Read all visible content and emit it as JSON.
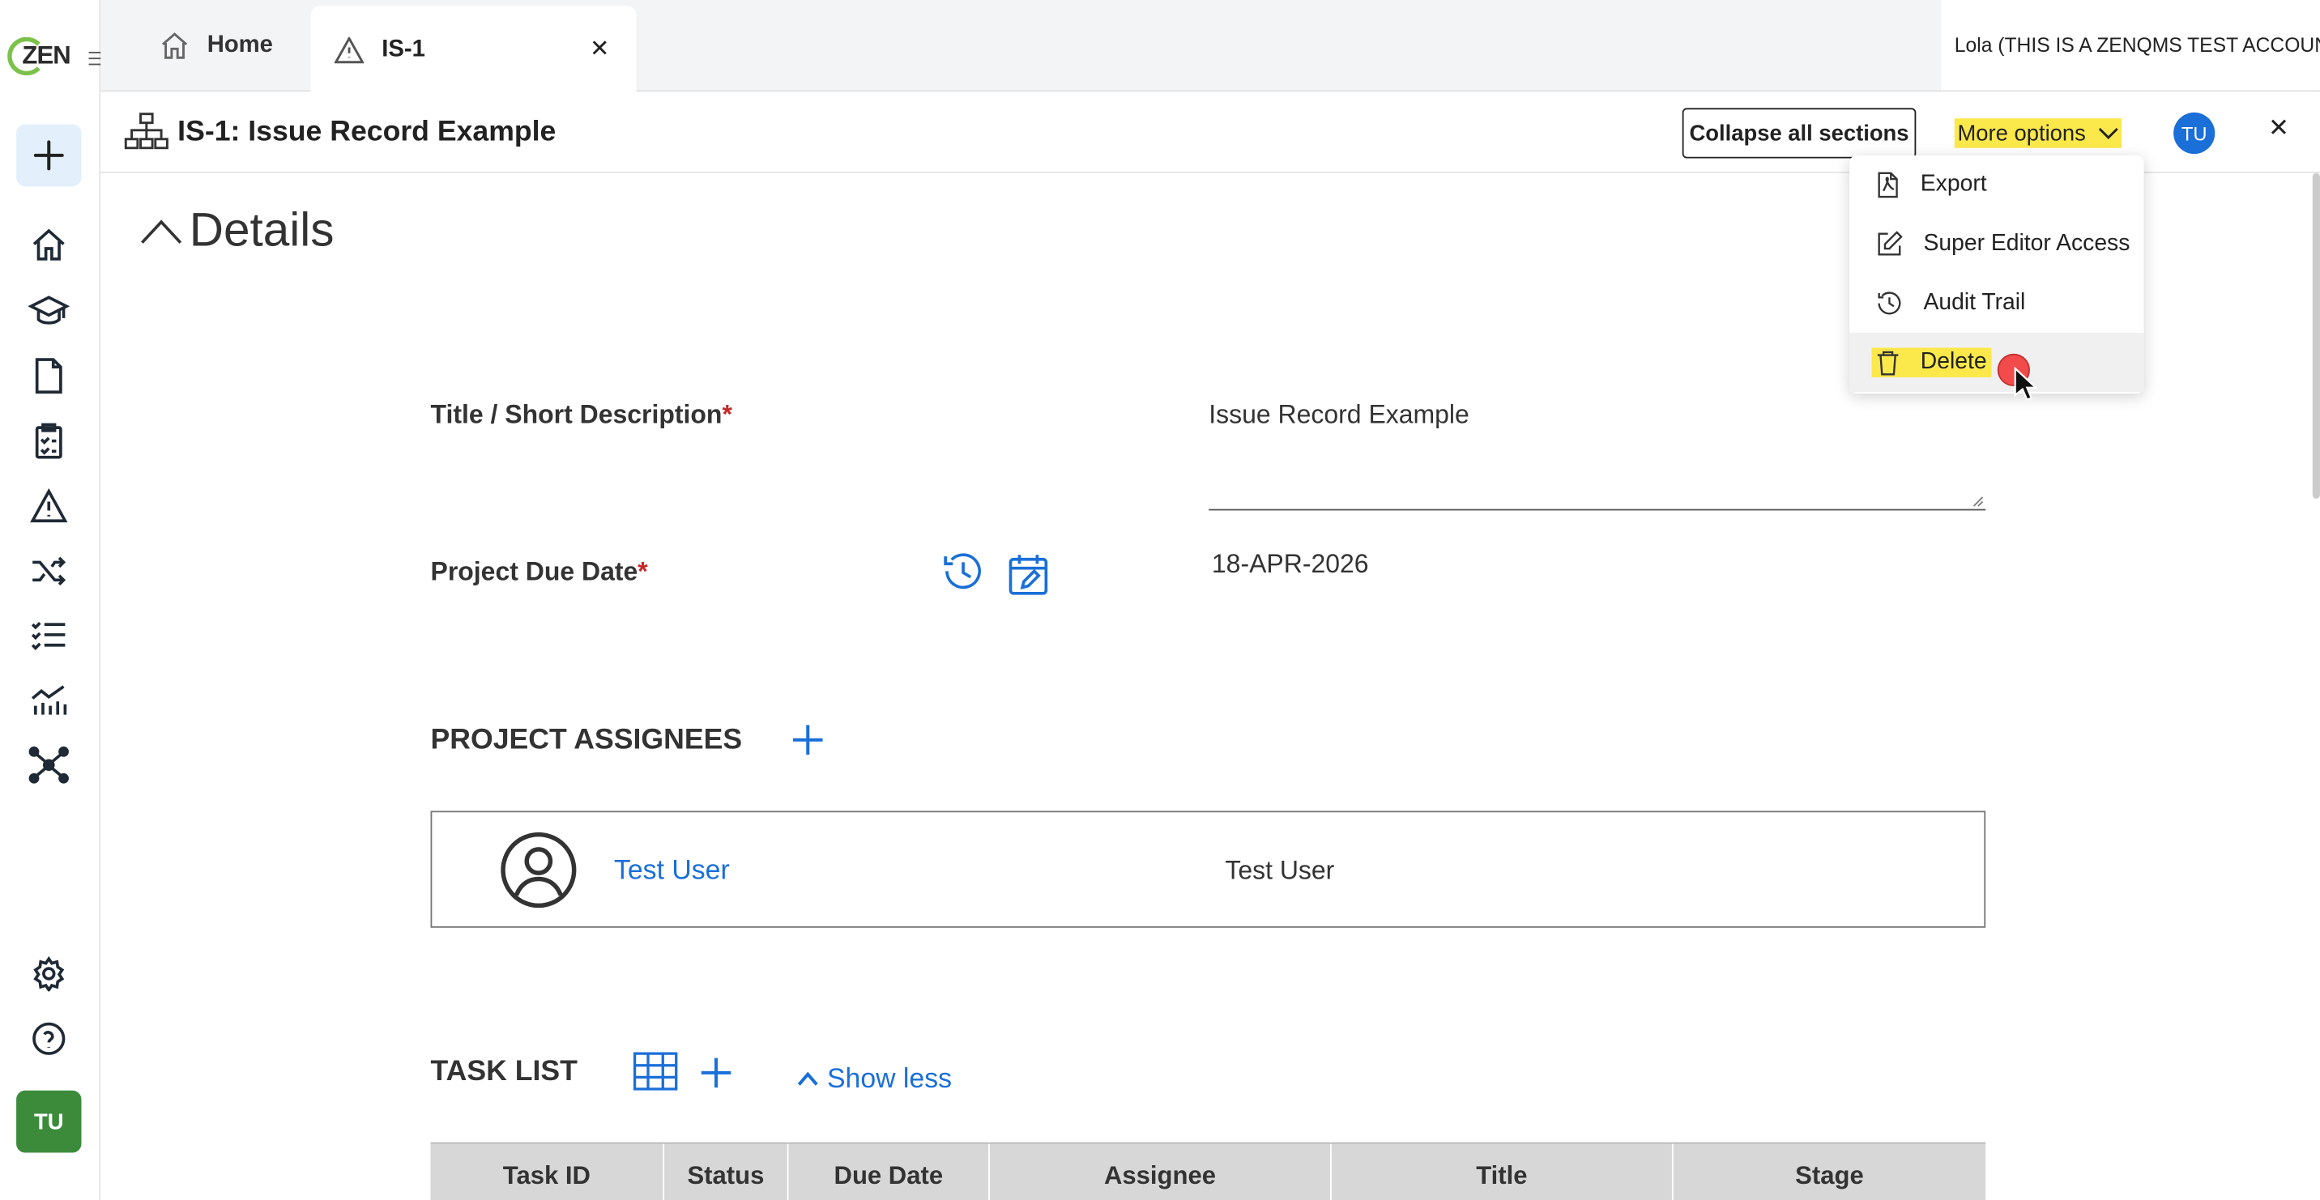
{
  "brand": {
    "logo_text": "ZEN",
    "accent": "#1a6fd8",
    "logo_green": "#7cc24a"
  },
  "sidebar": {
    "user_initials": "TU",
    "icons": [
      "plus-icon",
      "home-icon",
      "graduation-cap-icon",
      "document-icon",
      "clipboard-check-icon",
      "warning-icon",
      "shuffle-icon",
      "checklist-icon",
      "chart-icon",
      "network-icon",
      "gear-icon",
      "help-icon"
    ]
  },
  "tabs": [
    {
      "label": "Home",
      "icon": "home-icon"
    },
    {
      "label": "IS-1",
      "icon": "warning-icon",
      "active": true
    }
  ],
  "account_label": "Lola (THIS IS A ZENQMS TEST ACCOUNT)",
  "header": {
    "title": "IS-1: Issue Record Example",
    "collapse_label": "Collapse all sections",
    "more_options_label": "More options",
    "user_initials": "TU"
  },
  "menu": {
    "items": [
      {
        "label": "Export",
        "icon": "pdf-file-icon"
      },
      {
        "label": "Super Editor Access",
        "icon": "edit-icon"
      },
      {
        "label": "Audit Trail",
        "icon": "history-icon"
      },
      {
        "label": "Delete",
        "icon": "trash-icon"
      }
    ]
  },
  "details": {
    "heading": "Details",
    "title_label": "Title / Short Description",
    "title_value": "Issue Record Example",
    "due_label": "Project Due Date",
    "due_value": "18-APR-2026",
    "required_mark": "*"
  },
  "assignees": {
    "heading": "PROJECT ASSIGNEES",
    "link_name": "Test User",
    "name": "Test User"
  },
  "tasks": {
    "heading": "TASK LIST",
    "show_less_label": "Show less",
    "columns": [
      "Task ID",
      "Status",
      "Due Date",
      "Assignee",
      "Title",
      "Stage"
    ]
  }
}
